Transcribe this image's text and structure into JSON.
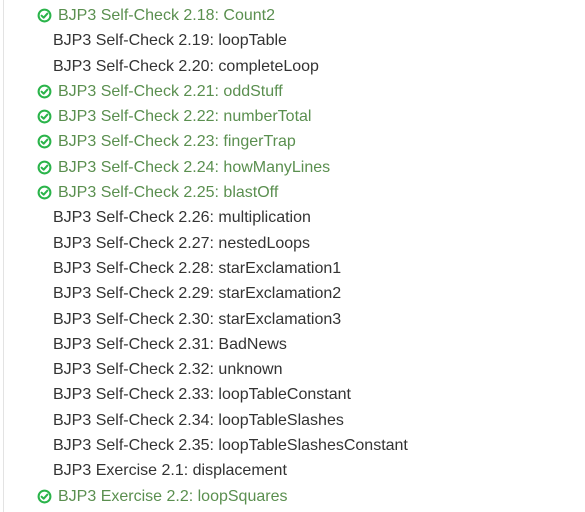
{
  "colors": {
    "completed_text": "#5a8f4f",
    "default_text": "#333333",
    "check_icon": "#2ab44a"
  },
  "items": [
    {
      "label": "BJP3 Self-Check 2.18: Count2",
      "completed": true
    },
    {
      "label": "BJP3 Self-Check 2.19: loopTable",
      "completed": false
    },
    {
      "label": "BJP3 Self-Check 2.20: completeLoop",
      "completed": false
    },
    {
      "label": "BJP3 Self-Check 2.21: oddStuff",
      "completed": true
    },
    {
      "label": "BJP3 Self-Check 2.22: numberTotal",
      "completed": true
    },
    {
      "label": "BJP3 Self-Check 2.23: fingerTrap",
      "completed": true
    },
    {
      "label": "BJP3 Self-Check 2.24: howManyLines",
      "completed": true
    },
    {
      "label": "BJP3 Self-Check 2.25: blastOff",
      "completed": true
    },
    {
      "label": "BJP3 Self-Check 2.26: multiplication",
      "completed": false
    },
    {
      "label": "BJP3 Self-Check 2.27: nestedLoops",
      "completed": false
    },
    {
      "label": "BJP3 Self-Check 2.28: starExclamation1",
      "completed": false
    },
    {
      "label": "BJP3 Self-Check 2.29: starExclamation2",
      "completed": false
    },
    {
      "label": "BJP3 Self-Check 2.30: starExclamation3",
      "completed": false
    },
    {
      "label": "BJP3 Self-Check 2.31: BadNews",
      "completed": false
    },
    {
      "label": "BJP3 Self-Check 2.32: unknown",
      "completed": false
    },
    {
      "label": "BJP3 Self-Check 2.33: loopTableConstant",
      "completed": false
    },
    {
      "label": "BJP3 Self-Check 2.34: loopTableSlashes",
      "completed": false
    },
    {
      "label": "BJP3 Self-Check 2.35: loopTableSlashesConstant",
      "completed": false
    },
    {
      "label": "BJP3 Exercise 2.1: displacement",
      "completed": false
    },
    {
      "label": "BJP3 Exercise 2.2: loopSquares",
      "completed": true
    }
  ]
}
